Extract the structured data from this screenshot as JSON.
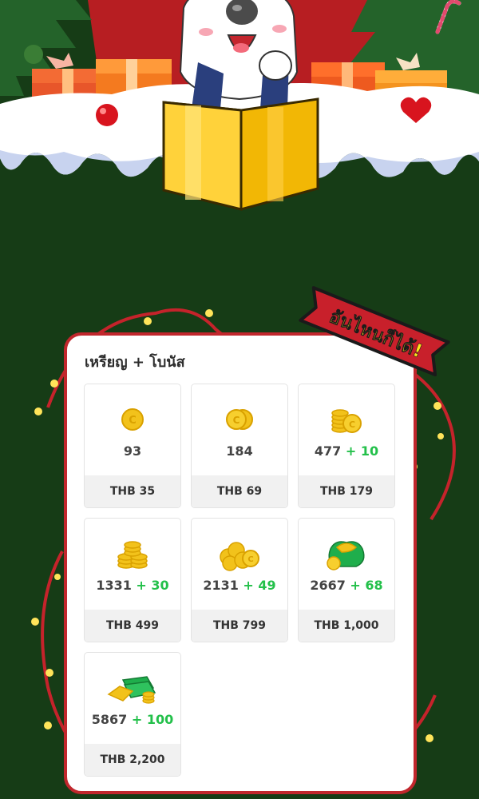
{
  "section": {
    "title": "เหรียญ + โบนัส",
    "ribbon_text": "อันไหนก็ได้!"
  },
  "packages": [
    {
      "coins": "93",
      "bonus": "",
      "price": "THB 35",
      "icon": "single-coin-icon"
    },
    {
      "coins": "184",
      "bonus": "",
      "price": "THB 69",
      "icon": "two-coins-icon"
    },
    {
      "coins": "477",
      "bonus": "+ 10",
      "price": "THB 179",
      "icon": "small-coin-stack-icon"
    },
    {
      "coins": "1331",
      "bonus": "+ 30",
      "price": "THB 499",
      "icon": "coin-stack-icon"
    },
    {
      "coins": "2131",
      "bonus": "+ 49",
      "price": "THB 799",
      "icon": "large-coin-pile-icon"
    },
    {
      "coins": "2667",
      "bonus": "+ 68",
      "price": "THB 1,000",
      "icon": "money-bag-icon"
    },
    {
      "coins": "5867",
      "bonus": "+ 100",
      "price": "THB 2,200",
      "icon": "treasure-pile-icon"
    }
  ],
  "colors": {
    "background": "#163c16",
    "card_border": "#c1272d",
    "bonus_green": "#23c04a",
    "coin_gold": "#f2c21b",
    "ribbon_red": "#c8202b"
  }
}
